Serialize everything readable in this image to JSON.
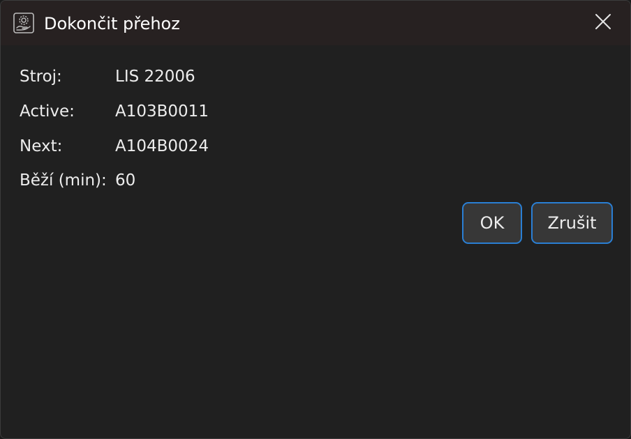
{
  "window": {
    "title": "Dokončit přehoz",
    "app_icon": "gear-hand-icon",
    "close_icon": "close-icon"
  },
  "fields": [
    {
      "label": "Stroj:",
      "value": "LIS 22006"
    },
    {
      "label": "Active:",
      "value": "A103B0011"
    },
    {
      "label": "Next:",
      "value": "A104B0024"
    },
    {
      "label": "Běží (min):",
      "value": "60"
    }
  ],
  "buttons": {
    "ok_label": "OK",
    "cancel_label": "Zrušit"
  },
  "colors": {
    "background": "#202020",
    "titlebar": "#272121",
    "text": "#ededed",
    "button_bg": "#373737",
    "accent_border": "#2a7fd4"
  }
}
